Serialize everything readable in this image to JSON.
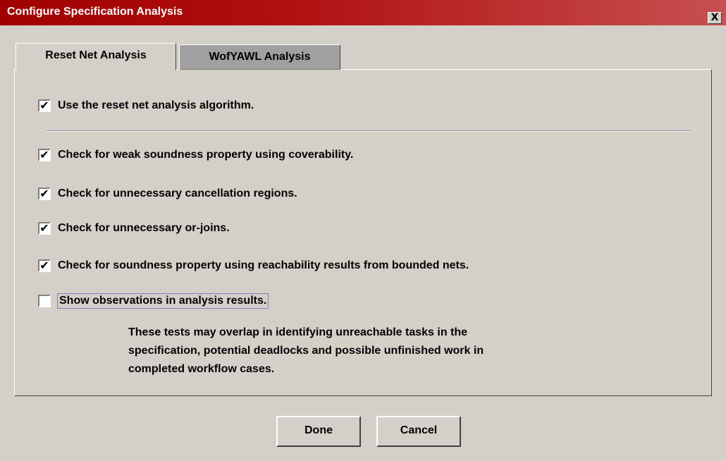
{
  "window": {
    "title": "Configure Specification Analysis",
    "close_label": "X"
  },
  "tabs": [
    {
      "label": "Reset Net Analysis",
      "selected": true
    },
    {
      "label": "WofYAWL Analysis",
      "selected": false
    }
  ],
  "options": [
    {
      "label": "Use the reset net analysis algorithm.",
      "checked": true
    },
    {
      "label": "Check for weak soundness property using coverability.",
      "checked": true
    },
    {
      "label": "Check for unnecessary cancellation regions.",
      "checked": true
    },
    {
      "label": "Check for unnecessary or-joins.",
      "checked": true
    },
    {
      "label": "Check for soundness property using reachability results from bounded nets.",
      "checked": true
    },
    {
      "label": "Show observations in analysis results.",
      "checked": false
    }
  ],
  "note": {
    "line1": "These tests may overlap in identifying unreachable tasks in the",
    "line2": "specification, potential deadlocks and possible unfinished work in",
    "line3": "completed workflow cases."
  },
  "buttons": {
    "done": "Done",
    "cancel": "Cancel"
  },
  "check_glyph": "✔"
}
